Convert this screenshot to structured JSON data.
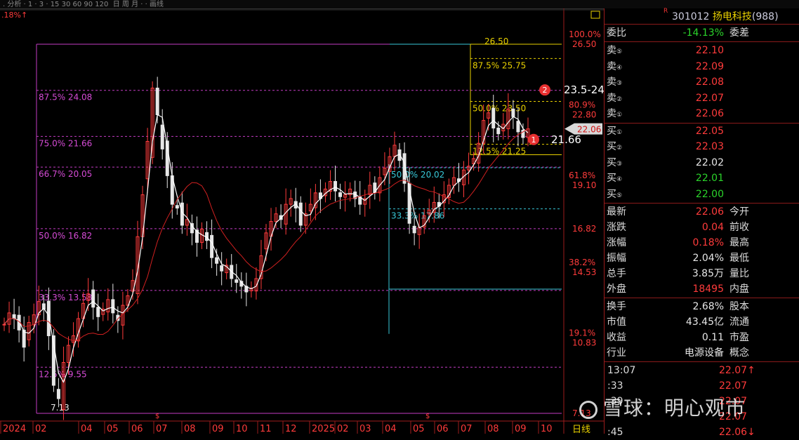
{
  "header": {
    "top_left_change": ".18%↑"
  },
  "stock": {
    "code": "301012",
    "name": "扬电科技",
    "suffix": "(988)"
  },
  "chart_data": {
    "type": "candlestick",
    "x_ticks": [
      "2024",
      "02",
      "04",
      "05",
      "06",
      "07",
      "08",
      "09",
      "10",
      "11",
      "12",
      "2025",
      "02",
      "03",
      "04",
      "05",
      "06",
      "07",
      "08",
      "09",
      "10"
    ],
    "right_axis": [
      {
        "label": "100.0%",
        "value": "26.50"
      },
      {
        "label": "80.9%",
        "value": "22.80"
      },
      {
        "label": "61.8%",
        "value": "19.10"
      },
      {
        "label": "",
        "value": "16.82"
      },
      {
        "label": "38.2%",
        "value": "14.53"
      },
      {
        "label": "19.1%",
        "value": "10.83"
      },
      {
        "label": "",
        "value": "7.13"
      }
    ],
    "current_price": "22.06",
    "fib_left": [
      {
        "text": "87.5% 24.08",
        "price": 24.08
      },
      {
        "text": "75.0% 21.66",
        "price": 21.66
      },
      {
        "text": "66.7% 20.05",
        "price": 20.05
      },
      {
        "text": "50.0% 16.82",
        "price": 16.82
      },
      {
        "text": "33.3% 13.58",
        "price": 13.58
      },
      {
        "text": "12.5% 9.55",
        "price": 9.55
      }
    ],
    "fib_left_top_price": 26.5,
    "fib_left_bottom": "7.13",
    "fib_mid": [
      {
        "text": "50.0% 20.02",
        "price": 20.02
      },
      {
        "text": "33.3% 17.86",
        "price": 17.86
      }
    ],
    "fib_right": [
      {
        "text": "26.50",
        "price": 26.5
      },
      {
        "text": "87.5% 25.75",
        "price": 25.75
      },
      {
        "text": "50.0% 23.50",
        "price": 23.5
      },
      {
        "text": "12.5% 21.25",
        "price": 21.25
      }
    ],
    "annotations": [
      {
        "num": "1",
        "text": "21.66"
      },
      {
        "num": "2",
        "text": "23.5-24.08"
      }
    ],
    "daily_label": "日线",
    "closes": [
      11.8,
      12.4,
      12.1,
      11.5,
      10.6,
      11.9,
      12.3,
      13.0,
      12.6,
      11.2,
      8.6,
      7.9,
      9.8,
      10.7,
      11.2,
      12.1,
      12.9,
      13.4,
      12.7,
      12.2,
      12.6,
      13.1,
      12.4,
      12.0,
      12.8,
      13.3,
      14.1,
      16.4,
      18.6,
      21.4,
      24.2,
      22.8,
      21.0,
      19.6,
      18.1,
      17.9,
      17.0,
      17.3,
      16.6,
      16.1,
      16.8,
      16.2,
      15.3,
      15.0,
      14.6,
      14.9,
      14.2,
      14.0,
      13.8,
      13.5,
      13.7,
      14.2,
      15.4,
      16.6,
      17.2,
      17.6,
      17.3,
      18.1,
      18.4,
      17.9,
      17.0,
      17.6,
      18.1,
      18.7,
      18.4,
      18.9,
      19.3,
      18.8,
      18.5,
      18.6,
      18.9,
      18.4,
      18.1,
      18.4,
      19.1,
      18.7,
      19.5,
      20.0,
      20.6,
      21.2,
      20.4,
      19.2,
      17.1,
      16.6,
      16.9,
      17.5,
      17.8,
      18.2,
      18.0,
      18.6,
      19.1,
      19.5,
      19.3,
      19.9,
      20.1,
      20.5,
      21.3,
      22.5,
      22.9,
      22.1,
      21.8,
      22.3,
      23.1,
      22.7,
      21.9,
      21.6,
      22.06
    ]
  },
  "quote": {
    "wei_bi_label": "委比",
    "wei_bi": "-14.13%",
    "wei_cha_label": "委差",
    "sell": [
      {
        "label": "卖",
        "num": "⑤",
        "price": "22.10"
      },
      {
        "label": "卖",
        "num": "④",
        "price": "22.09"
      },
      {
        "label": "卖",
        "num": "③",
        "price": "22.08"
      },
      {
        "label": "卖",
        "num": "②",
        "price": "22.07"
      },
      {
        "label": "卖",
        "num": "①",
        "price": "22.06"
      }
    ],
    "buy": [
      {
        "label": "买",
        "num": "①",
        "price": "22.05"
      },
      {
        "label": "买",
        "num": "②",
        "price": "22.03"
      },
      {
        "label": "买",
        "num": "③",
        "price": "22.02"
      },
      {
        "label": "买",
        "num": "④",
        "price": "22.01"
      },
      {
        "label": "买",
        "num": "⑤",
        "price": "22.00"
      }
    ],
    "stats": [
      {
        "k": "最新",
        "v": "22.06",
        "k2": "今开",
        "color": "red"
      },
      {
        "k": "涨跌",
        "v": "0.04",
        "k2": "前收",
        "color": "red"
      },
      {
        "k": "涨幅",
        "v": "0.18%",
        "k2": "最高",
        "color": "red"
      },
      {
        "k": "振幅",
        "v": "2.04%",
        "k2": "最低",
        "color": "white"
      },
      {
        "k": "总手",
        "v": "3.85万",
        "k2": "量比",
        "color": "white"
      },
      {
        "k": "外盘",
        "v": "18495",
        "k2": "内盘",
        "color": "red"
      },
      {
        "k": "换手",
        "v": "2.68%",
        "k2": "股本",
        "color": "white"
      },
      {
        "k": "市值",
        "v": "43.45亿",
        "k2": "流通",
        "color": "white"
      },
      {
        "k": "收益",
        "v": "0.11",
        "k2": "市盈",
        "color": "white"
      },
      {
        "k": "行业",
        "v": "电源设备",
        "k2": "概念",
        "color": "white"
      }
    ],
    "ticks": [
      {
        "t": "13:07",
        "p": "22.07↑",
        "color": "red"
      },
      {
        "t": ":33",
        "p": "22.07",
        "color": "red"
      },
      {
        "t": ":39",
        "p": "22.07",
        "color": "red"
      },
      {
        "t": "",
        "p": "22.07",
        "color": "red"
      },
      {
        "t": ":45",
        "p": "22.06↓",
        "color": "red"
      }
    ]
  },
  "watermark": "雪球：明心观市"
}
